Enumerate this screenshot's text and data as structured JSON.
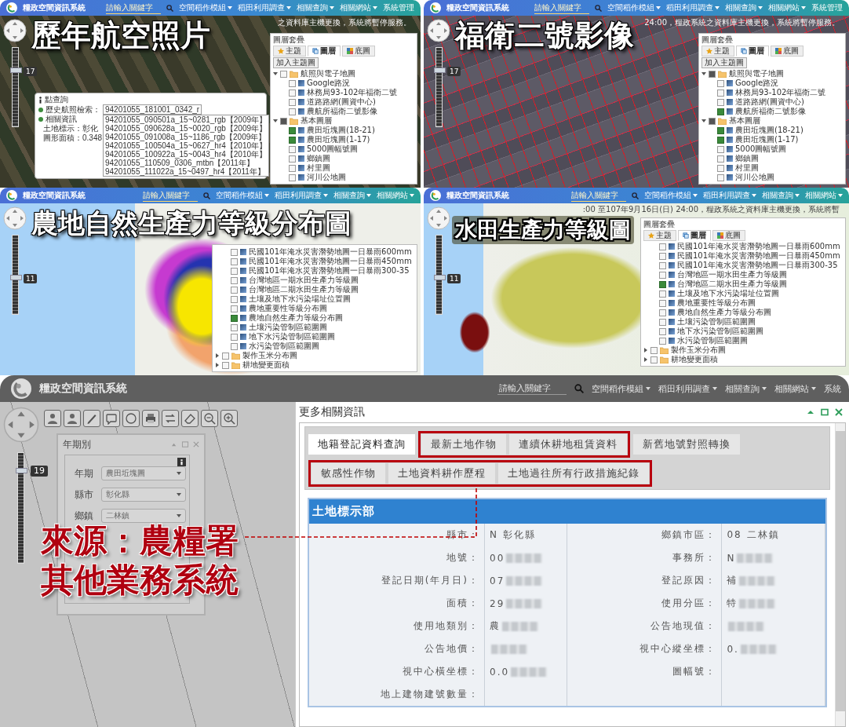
{
  "panels": [
    {
      "kind": "aerial",
      "header": {
        "title": "糧政空間資訊系統",
        "search": {
          "placeholder": "請輸入關鍵字"
        },
        "nav": [
          {
            "label": "空間稻作模組",
            "dropdown": true
          },
          {
            "label": "稻田利用調查",
            "dropdown": true
          },
          {
            "label": "相關查詢",
            "dropdown": true
          },
          {
            "label": "相關網站",
            "dropdown": true
          },
          {
            "label": "系統管理",
            "dropdown": false
          }
        ]
      },
      "caption": "歷年航空照片",
      "notice": "之資料庫主機更換，系統將暫停服務。",
      "zoom": {
        "label": "17",
        "level": 0.7
      },
      "layer_panel": {
        "title": "圖層套疊",
        "tabs": [
          {
            "label": "主題",
            "selected": false
          },
          {
            "label": "圖層",
            "selected": true
          },
          {
            "label": "底圖",
            "selected": false
          }
        ],
        "add_button": "加入主題圖",
        "tree": [
          {
            "kind": "folder",
            "label": "航照與電子地圖",
            "expanded": true,
            "partial": false,
            "children": [
              {
                "kind": "layer",
                "label": "Google路況",
                "checked": false
              },
              {
                "kind": "layer",
                "label": "林務局93-102年福衛二號",
                "checked": false
              },
              {
                "kind": "layer",
                "label": "道路路網(圖資中心)",
                "checked": false
              },
              {
                "kind": "layer",
                "label": "農航所福衛二號影像",
                "checked": false
              }
            ]
          },
          {
            "kind": "folder",
            "label": "基本圖層",
            "expanded": true,
            "partial": true,
            "children": [
              {
                "kind": "layer",
                "label": "農田坵塊圖(18-21)",
                "checked": true
              },
              {
                "kind": "layer",
                "label": "農田坵塊圖(1-17)",
                "checked": true
              },
              {
                "kind": "layer",
                "label": "5000圖幅號圖",
                "checked": false
              },
              {
                "kind": "layer",
                "label": "鄉鎮圖",
                "checked": false
              },
              {
                "kind": "layer",
                "label": "村里圖",
                "checked": false
              },
              {
                "kind": "layer",
                "label": "河川公地圖",
                "checked": false
              }
            ]
          }
        ]
      },
      "popup": {
        "title": "點查詢",
        "search_label": "歷史航照檢索：",
        "select_value": "94201055_181001_0342_r",
        "info_title": "相關資訊",
        "info_lines": [
          "土地標示：彰化",
          "圖形面積：0.348"
        ],
        "options": [
          "94201055_090501a_15~0281_rgb【2009年】",
          "94201055_090628a_15~0020_rgb【2009年】",
          "94201055_091008a_15~1186_rgb【2009年】",
          "94201055_100504a_15~0627_hr4【2010年】",
          "94201055_100922a_15~0043_hr4【2010年】",
          "94201055_110509_0306_mtbn【2011年】",
          "94201055_111022a_15~0497_hr4【2011年】"
        ]
      }
    },
    {
      "kind": "satellite",
      "header": {
        "title": "糧政空間資訊系統",
        "search": {
          "placeholder": "請輸入關鍵字"
        },
        "nav": [
          {
            "label": "空間稻作模組",
            "dropdown": true
          },
          {
            "label": "稻田利用調查",
            "dropdown": true
          },
          {
            "label": "相關查詢",
            "dropdown": true
          },
          {
            "label": "相關網站",
            "dropdown": true
          },
          {
            "label": "系統管理",
            "dropdown": false
          }
        ]
      },
      "caption": "福衛二號影像",
      "notice": "24:00，糧政系統之資料庫主機更換，系統將暫停服務。",
      "zoom": {
        "label": "17",
        "level": 0.7
      },
      "layer_panel": {
        "title": "圖層套疊",
        "tabs": [
          {
            "label": "主題",
            "selected": false
          },
          {
            "label": "圖層",
            "selected": true
          },
          {
            "label": "底圖",
            "selected": false
          }
        ],
        "add_button": "加入主題圖",
        "tree": [
          {
            "kind": "folder",
            "label": "航照與電子地圖",
            "expanded": true,
            "partial": true,
            "children": [
              {
                "kind": "layer",
                "label": "Google路況",
                "checked": false
              },
              {
                "kind": "layer",
                "label": "林務局93-102年福衛二號",
                "checked": false
              },
              {
                "kind": "layer",
                "label": "道路路網(圖資中心)",
                "checked": false
              },
              {
                "kind": "layer",
                "label": "農航所福衛二號影像",
                "checked": true
              }
            ]
          },
          {
            "kind": "folder",
            "label": "基本圖層",
            "expanded": true,
            "partial": true,
            "children": [
              {
                "kind": "layer",
                "label": "農田坵塊圖(18-21)",
                "checked": true
              },
              {
                "kind": "layer",
                "label": "農田坵塊圖(1-17)",
                "checked": true
              },
              {
                "kind": "layer",
                "label": "5000圖幅號圖",
                "checked": false
              },
              {
                "kind": "layer",
                "label": "鄉鎮圖",
                "checked": false
              },
              {
                "kind": "layer",
                "label": "村里圖",
                "checked": false
              },
              {
                "kind": "layer",
                "label": "河川公地圖",
                "checked": false
              }
            ]
          }
        ]
      }
    },
    {
      "kind": "soil",
      "header": {
        "title": "糧政空間資訊系統",
        "search": {
          "placeholder": "請輸入關鍵字"
        },
        "nav": [
          {
            "label": "空間稻作模組",
            "dropdown": true
          },
          {
            "label": "稻田利用調查",
            "dropdown": true
          },
          {
            "label": "相關查詢",
            "dropdown": true
          },
          {
            "label": "相關網站",
            "dropdown": true
          }
        ]
      },
      "caption": "農地自然生產力等級分布圖",
      "zoom": {
        "label": "11",
        "level": 0.45
      },
      "layer_panel": {
        "tree": [
          {
            "kind": "layer",
            "label": "民國101年淹水災害潛勢地圖一日暴雨600mm",
            "checked": false
          },
          {
            "kind": "layer",
            "label": "民國101年淹水災害潛勢地圖一日暴雨450mm",
            "checked": false
          },
          {
            "kind": "layer",
            "label": "民國101年淹水災害潛勢地圖一日暴雨300-35",
            "checked": false
          },
          {
            "kind": "layer",
            "label": "台灣地區一期水田生產力等級圖",
            "checked": false
          },
          {
            "kind": "layer",
            "label": "台灣地區二期水田生產力等級圖",
            "checked": false
          },
          {
            "kind": "layer",
            "label": "土壤及地下水污染場址位置圖",
            "checked": false
          },
          {
            "kind": "layer",
            "label": "農地重要性等級分布圖",
            "checked": false
          },
          {
            "kind": "layer",
            "label": "農地自然生產力等級分布圖",
            "checked": true
          },
          {
            "kind": "layer",
            "label": "土壤污染管制區範圍圖",
            "checked": false
          },
          {
            "kind": "layer",
            "label": "地下水污染管制區範圍圖",
            "checked": false
          },
          {
            "kind": "layer",
            "label": "水污染管制區範圍圖",
            "checked": false
          },
          {
            "kind": "folder",
            "label": "製作玉米分布圖",
            "expanded": false,
            "partial": false
          },
          {
            "kind": "folder",
            "label": "耕地變更面積",
            "expanded": false,
            "partial": false
          }
        ]
      }
    },
    {
      "kind": "paddy",
      "header": {
        "title": "糧政空間資訊系統",
        "search": {
          "placeholder": "請輸入關鍵字"
        },
        "nav": [
          {
            "label": "空間稻作模組",
            "dropdown": true
          },
          {
            "label": "稻田利用調查",
            "dropdown": true
          },
          {
            "label": "相關查詢",
            "dropdown": true
          },
          {
            "label": "相關網站",
            "dropdown": true
          }
        ]
      },
      "caption": "水田生產力等級圖",
      "notice": ":00 至107年9月16日(日) 24:00，糧政系統之資料庫主機更換，系統將暫",
      "zoom": {
        "label": "11",
        "level": 0.45
      },
      "layer_panel": {
        "title": "圖層套疊",
        "tabs": [
          {
            "label": "主題",
            "selected": false
          },
          {
            "label": "圖層",
            "selected": true
          },
          {
            "label": "底圖",
            "selected": false
          }
        ],
        "tree": [
          {
            "kind": "layer",
            "label": "民國101年淹水災害潛勢地圖一日暴雨600mm",
            "checked": false
          },
          {
            "kind": "layer",
            "label": "民國101年淹水災害潛勢地圖一日暴雨450mm",
            "checked": false
          },
          {
            "kind": "layer",
            "label": "民國101年淹水災害潛勢地圖一日暴雨300-35",
            "checked": false
          },
          {
            "kind": "layer",
            "label": "台灣地區一期水田生產力等級圖",
            "checked": false
          },
          {
            "kind": "layer",
            "label": "台灣地區二期水田生產力等級圖",
            "checked": true
          },
          {
            "kind": "layer",
            "label": "土壤及地下水污染場址位置圖",
            "checked": false
          },
          {
            "kind": "layer",
            "label": "農地重要性等級分布圖",
            "checked": false
          },
          {
            "kind": "layer",
            "label": "農地自然生產力等級分布圖",
            "checked": false
          },
          {
            "kind": "layer",
            "label": "土壤污染管制區範圍圖",
            "checked": false
          },
          {
            "kind": "layer",
            "label": "地下水污染管制區範圍圖",
            "checked": false
          },
          {
            "kind": "layer",
            "label": "水污染管制區範圍圖",
            "checked": false
          },
          {
            "kind": "folder",
            "label": "製作玉米分布圖",
            "expanded": false,
            "partial": false
          },
          {
            "kind": "folder",
            "label": "耕地變更面積",
            "expanded": false,
            "partial": false
          }
        ]
      }
    }
  ],
  "detail": {
    "header": {
      "title": "糧政空間資訊系統",
      "search": {
        "placeholder": "請輸入關鍵字"
      },
      "nav": [
        {
          "label": "空間稻作模組",
          "dropdown": true
        },
        {
          "label": "稻田利用調查",
          "dropdown": true
        },
        {
          "label": "相關查詢",
          "dropdown": true
        },
        {
          "label": "相關網站",
          "dropdown": true
        },
        {
          "label": "系統",
          "dropdown": false
        }
      ]
    },
    "toolbar": [
      {
        "kind": "person"
      },
      {
        "kind": "person"
      },
      {
        "kind": "pencil"
      },
      {
        "kind": "speech"
      },
      {
        "kind": "circle"
      },
      {
        "kind": "printer"
      },
      {
        "kind": "swap"
      },
      {
        "kind": "eraser"
      },
      {
        "kind": "zoom-out"
      },
      {
        "kind": "zoom-in"
      }
    ],
    "zoom": {
      "label": "19",
      "level": 0.83
    },
    "dialog": {
      "title": "年期別",
      "fields": [
        {
          "label": "年期",
          "value": "農田坵塊圖"
        },
        {
          "label": "縣市",
          "value": "彰化縣"
        },
        {
          "label": "鄉鎮",
          "value": "二林鎮"
        }
      ]
    },
    "caption": [
      "來源：農糧署",
      "其他業務系統"
    ],
    "window": {
      "title": "更多相關資訊",
      "tab_rows": [
        {
          "tabs": [
            {
              "label": "地籍登記資料查詢",
              "selected": true,
              "highlighted": false
            },
            {
              "label": "最新土地作物",
              "selected": false,
              "highlighted": true
            },
            {
              "label": "連續休耕地租賃資料",
              "selected": false,
              "highlighted": true
            },
            {
              "label": "新舊地號對照轉換",
              "selected": false,
              "highlighted": false
            }
          ]
        },
        {
          "tabs": [
            {
              "label": "敏感性作物",
              "selected": false,
              "highlighted": true
            },
            {
              "label": "土地資料耕作歷程",
              "selected": false,
              "highlighted": true
            },
            {
              "label": "土地過往所有行政措施紀錄",
              "selected": false,
              "highlighted": true
            }
          ]
        }
      ],
      "section_title": "土地標示部",
      "rows": [
        {
          "cells": [
            {
              "label": "縣市：",
              "value": "N 彰化縣",
              "redacted": false
            },
            {
              "label": "鄉鎮市區：",
              "value": "08 二林鎮",
              "redacted": false
            }
          ]
        },
        {
          "cells": [
            {
              "label": "地號：",
              "value": "00",
              "redacted": true
            },
            {
              "label": "事務所：",
              "value": "N",
              "redacted": true
            }
          ]
        },
        {
          "cells": [
            {
              "label": "登記日期(年月日)：",
              "value": "07",
              "redacted": true
            },
            {
              "label": "登記原因：",
              "value": "補",
              "redacted": true
            }
          ]
        },
        {
          "cells": [
            {
              "label": "面積：",
              "value": "29",
              "redacted": true
            },
            {
              "label": "使用分區：",
              "value": "特",
              "redacted": true
            }
          ]
        },
        {
          "cells": [
            {
              "label": "使用地類別：",
              "value": "農",
              "redacted": true
            },
            {
              "label": "公告地現值：",
              "redacted": true
            }
          ]
        },
        {
          "cells": [
            {
              "label": "公告地價：",
              "redacted": true
            },
            {
              "label": "視中心縱坐標：",
              "value": "0.",
              "redacted": true
            }
          ]
        },
        {
          "cells": [
            {
              "label": "視中心橫坐標：",
              "value": "0.0",
              "redacted": true
            },
            {
              "label": "圖幅號：",
              "redacted": false
            }
          ]
        },
        {
          "cells": [
            {
              "label": "地上建物建號數量：",
              "redacted": false
            }
          ]
        }
      ]
    }
  }
}
